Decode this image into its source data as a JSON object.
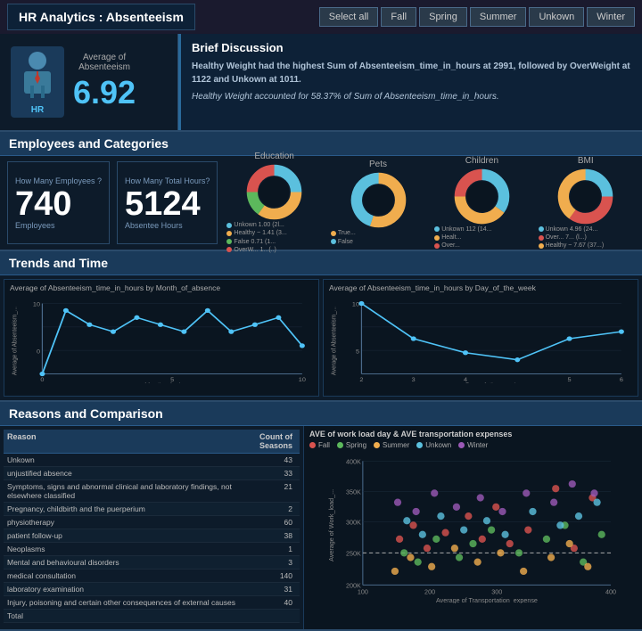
{
  "header": {
    "title": "HR Analytics : Absenteeism",
    "filters": [
      "Select all",
      "Fall",
      "Spring",
      "Summer",
      "Unkown",
      "Winter"
    ]
  },
  "kpi": {
    "label": "Average of\nAbsenteeism",
    "value": "6.92",
    "hr_label": "HR"
  },
  "brief": {
    "title": "Brief Discussion",
    "text1": "Healthy Weight had the highest Sum of Absenteeism_time_in_hours at 2991, followed by OverWeight at 1122 and Unkown at 1011.",
    "text2": "Healthy Weight accounted for 58.37% of Sum of Absenteeism_time_in_hours."
  },
  "employees_section": {
    "title": "Employees and  Categories",
    "how_many_employees_label": "How Many Employees ?",
    "how_many_hours_label": "How Many Total Hours?",
    "employees_count": "740",
    "employees_label": "Employees",
    "hours_count": "5124",
    "hours_label": "Absentee Hours"
  },
  "donuts": [
    {
      "title": "Education",
      "segments": [
        {
          "label": "Unkown",
          "value": "1.00 (2l...",
          "color": "#5bc0de"
        },
        {
          "label": "Healthy ~",
          "value": "1.41 (3...",
          "color": "#f0ad4e"
        },
        {
          "label": "False",
          "value": "0.71 (1...",
          "color": "#5cb85c"
        },
        {
          "label": "OverW...",
          "value": "1...(..)",
          "color": "#d9534f"
        }
      ]
    },
    {
      "title": "Pets",
      "segments": [
        {
          "label": "True...",
          "value": "",
          "color": "#f0ad4e"
        },
        {
          "label": "False",
          "value": "",
          "color": "#5bc0de"
        }
      ]
    },
    {
      "title": "Children",
      "segments": [
        {
          "label": "Unkown",
          "value": "112 (14...",
          "color": "#5bc0de"
        },
        {
          "label": "Healt...",
          "value": "",
          "color": "#f0ad4e"
        },
        {
          "label": "Over...",
          "value": "",
          "color": "#d9534f"
        }
      ]
    },
    {
      "title": "BMI",
      "segments": [
        {
          "label": "Unkown",
          "value": "4.96 (24...",
          "color": "#5bc0de"
        },
        {
          "label": "Over...",
          "value": "7... (l...)",
          "color": "#d9534f"
        },
        {
          "label": "Healthy ~",
          "value": "7.67 (37...)",
          "color": "#f0ad4e"
        }
      ]
    }
  ],
  "trends": {
    "title": "Trends and Time",
    "chart1_title": "Average of Absenteeism_time_in_hours by Month_of_absence",
    "chart1_x_label": "Month_of_absence",
    "chart1_y_label": "Average of Absenteeism_...",
    "chart1_data": [
      0,
      9,
      7,
      6,
      8,
      7,
      6,
      9,
      6,
      7,
      8,
      4
    ],
    "chart2_title": "Average of Absenteeism_time_in_hours by Day_of_the_week",
    "chart2_x_label": "Day_of_the_week",
    "chart2_y_label": "Average of Absenteeism_...",
    "chart2_data": [
      10,
      5,
      3,
      2,
      5,
      6
    ]
  },
  "reasons": {
    "title": "Reasons and Comparison",
    "table_headers": [
      "Reason",
      "Count of\nSeasons"
    ],
    "filter_label": "▼",
    "rows": [
      {
        "reason": "Unkown",
        "count": "43"
      },
      {
        "reason": "unjustified absence",
        "count": "33"
      },
      {
        "reason": "Symptoms, signs and abnormal clinical and laboratory findings, not elsewhere classified",
        "count": "21"
      },
      {
        "reason": "Pregnancy, childbirth and the puerperium",
        "count": "2"
      },
      {
        "reason": "physiotherapy",
        "count": "60"
      },
      {
        "reason": "patient follow-up",
        "count": "38"
      },
      {
        "reason": "Neoplasms",
        "count": "1"
      },
      {
        "reason": "Mental and behavioural disorders",
        "count": "3"
      },
      {
        "reason": "medical consultation",
        "count": "140"
      },
      {
        "reason": "laboratory examination",
        "count": "31"
      },
      {
        "reason": "Injury, poisoning and certain other consequences of external causes",
        "count": "40"
      },
      {
        "reason": "Total",
        "count": ""
      }
    ]
  },
  "scatter": {
    "title": "AVE of work load day & AVE transportation expenses",
    "legend": [
      "Fall",
      "Spring",
      "Summer",
      "Unkown",
      "Winter"
    ],
    "legend_colors": [
      "#d9534f",
      "#5cb85c",
      "#f0ad4e",
      "#5bc0de",
      "#9b59b6"
    ],
    "x_label": "Average of Transportation_expense",
    "y_label": "Average of Work_load_...",
    "y_ticks": [
      "400K",
      "350K",
      "300K",
      "250K",
      "200K"
    ],
    "x_ticks": [
      "100",
      "200",
      "300",
      "400"
    ],
    "dashed_line_y": 260
  }
}
